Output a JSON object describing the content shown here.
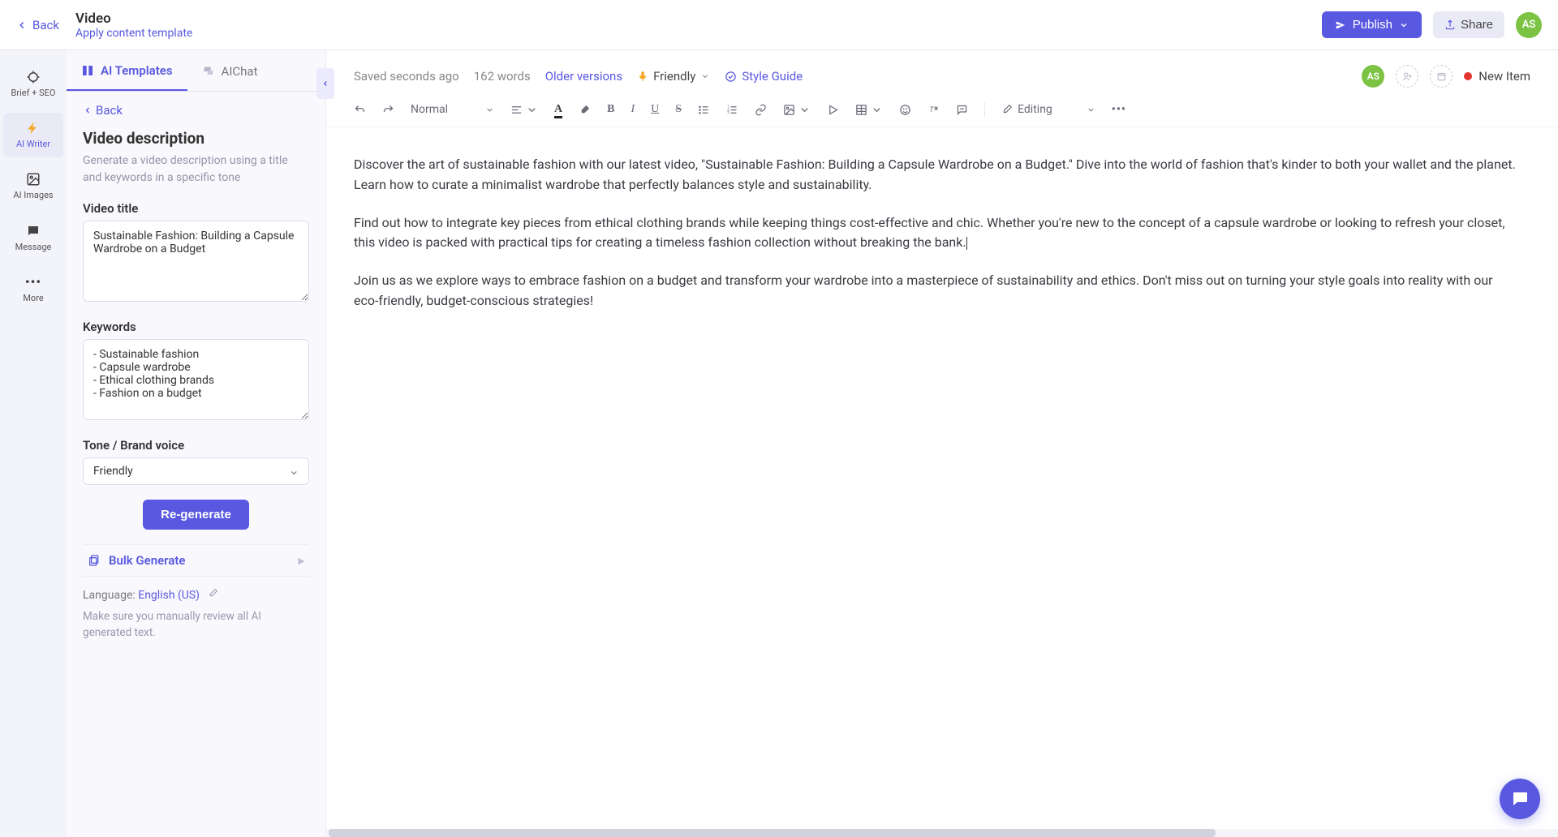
{
  "header": {
    "back_label": "Back",
    "title": "Video",
    "template_link": "Apply content template",
    "publish_label": "Publish",
    "share_label": "Share",
    "avatar_initials": "AS"
  },
  "rail": {
    "items": [
      {
        "label": "Brief + SEO"
      },
      {
        "label": "AI Writer"
      },
      {
        "label": "AI Images"
      },
      {
        "label": "Message"
      },
      {
        "label": "More"
      }
    ]
  },
  "sidebar": {
    "tabs": {
      "templates": "AI Templates",
      "chat": "AIChat"
    },
    "back_label": "Back",
    "heading": "Video description",
    "description": "Generate a video description using a title and keywords in a specific tone",
    "video_title_label": "Video title",
    "video_title_value": "Sustainable Fashion: Building a Capsule Wardrobe on a Budget",
    "keywords_label": "Keywords",
    "keywords_value": "- Sustainable fashion\n- Capsule wardrobe\n- Ethical clothing brands\n- Fashion on a budget",
    "tone_label": "Tone / Brand voice",
    "tone_value": "Friendly",
    "regenerate_label": "Re-generate",
    "bulk_label": "Bulk Generate",
    "language_prefix": "Language: ",
    "language_value": "English (US)",
    "warning": "Make sure you manually review all AI generated text."
  },
  "editor": {
    "saved_text": "Saved seconds ago",
    "word_count": "162 words",
    "older_versions": "Older versions",
    "tone_value": "Friendly",
    "style_guide": "Style Guide",
    "avatar_initials": "AS",
    "status_label": "New Item",
    "style_select": "Normal",
    "editing_select": "Editing"
  },
  "document": {
    "p1": "Discover the art of sustainable fashion with our latest video, \"Sustainable Fashion: Building a Capsule Wardrobe on a Budget.\" Dive into the world of fashion that's kinder to both your wallet and the planet. Learn how to curate a minimalist wardrobe that perfectly balances style and sustainability.",
    "p2": "Find out how to integrate key pieces from ethical clothing brands while keeping things cost-effective and chic. Whether you're new to the concept of a capsule wardrobe or looking to refresh your closet, this video is packed with practical tips for creating a timeless fashion collection without breaking the bank.",
    "p3": "Join us as we explore ways to embrace fashion on a budget and transform your wardrobe into a masterpiece of sustainability and ethics. Don't miss out on turning your style goals into reality with our eco-friendly, budget-conscious strategies!"
  }
}
